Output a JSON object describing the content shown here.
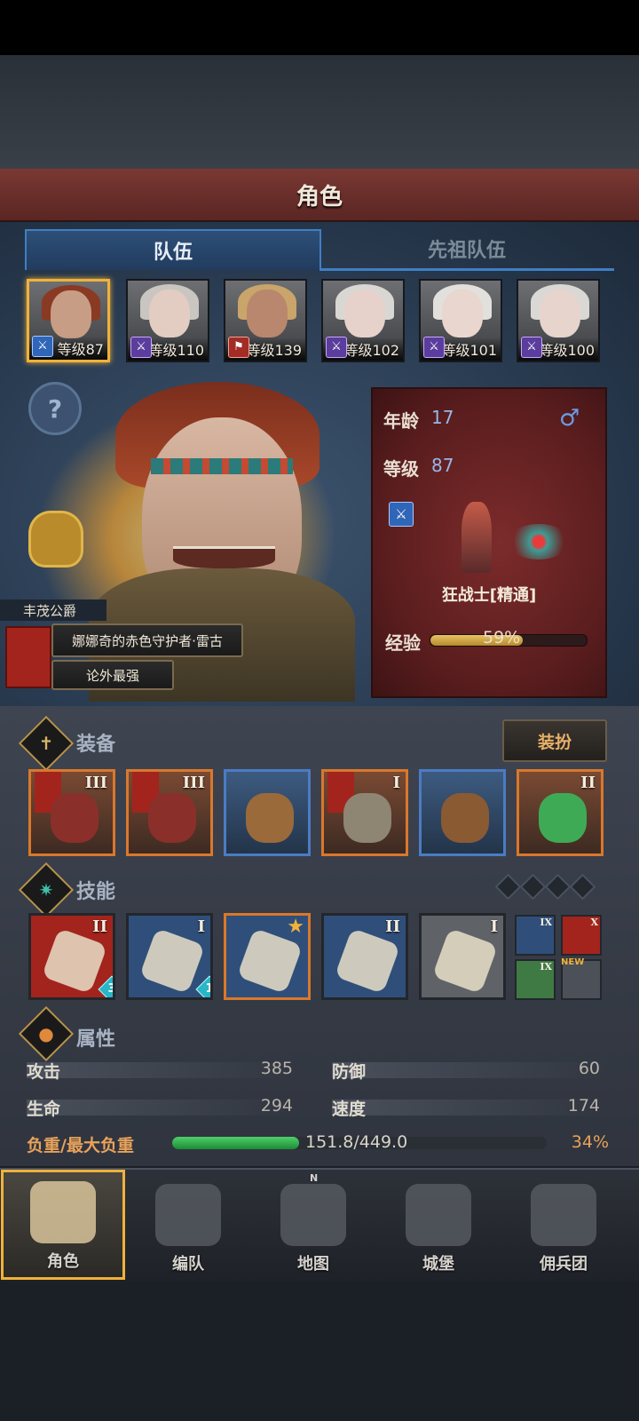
{
  "header": {
    "title": "角色"
  },
  "tabs": [
    {
      "label": "队伍",
      "active": true
    },
    {
      "label": "先祖队伍",
      "active": false
    }
  ],
  "team": [
    {
      "level_text": "等级87",
      "class": "blue",
      "selected": true,
      "hair": "#8a3a22",
      "skin": "#c79d86"
    },
    {
      "level_text": "等级110",
      "class": "purple",
      "selected": false,
      "hair": "#c9c6c2",
      "skin": "#e3ccc2"
    },
    {
      "level_text": "等级139",
      "class": "red",
      "selected": false,
      "hair": "#c9a46b",
      "skin": "#b9876d"
    },
    {
      "level_text": "等级102",
      "class": "purple",
      "selected": false,
      "hair": "#d9d7d3",
      "skin": "#e6d2cb"
    },
    {
      "level_text": "等级101",
      "class": "purple",
      "selected": false,
      "hair": "#e2e0dc",
      "skin": "#e9d6cf"
    },
    {
      "level_text": "等级100",
      "class": "purple",
      "selected": false,
      "hair": "#dad8d4",
      "skin": "#e6d4cd"
    }
  ],
  "hero": {
    "title_tag": "丰茂公爵",
    "title_main": "娜娜奇的赤色守护者·雷古",
    "title_sub": "论外最强",
    "help_label": "?"
  },
  "info": {
    "age_label": "年龄",
    "age": "17",
    "gender_symbol": "♂",
    "level_label": "等级",
    "level": "87",
    "class_name": "狂战士[精通]",
    "exp_label": "经验",
    "exp_percent_text": "59%",
    "exp_fraction": 0.59
  },
  "equipment": {
    "title": "装备",
    "dress_button": "装扮",
    "slots": [
      {
        "tier": "III",
        "quality": "orange",
        "flag": true,
        "color": "#8b2f2a"
      },
      {
        "tier": "III",
        "quality": "orange",
        "flag": true,
        "color": "#8b2f2a"
      },
      {
        "tier": "",
        "quality": "blue",
        "flag": false,
        "color": "#9a6a3a"
      },
      {
        "tier": "I",
        "quality": "orange",
        "flag": true,
        "color": "#8e8573"
      },
      {
        "tier": "",
        "quality": "blue",
        "flag": false,
        "color": "#8a5a33"
      },
      {
        "tier": "II",
        "quality": "orange",
        "flag": false,
        "color": "#3faa55"
      }
    ]
  },
  "skills": {
    "title": "技能",
    "items": [
      {
        "tier": "II",
        "bg": "#a3241d",
        "badge": "3",
        "star": false
      },
      {
        "tier": "I",
        "bg": "#2f4f7a",
        "badge": "1",
        "star": false
      },
      {
        "tier": "",
        "bg": "#2f4f7a",
        "badge": "",
        "star": true
      },
      {
        "tier": "II",
        "bg": "#2f4f7a",
        "badge": "",
        "star": false
      },
      {
        "tier": "I",
        "bg": "#5f6368",
        "badge": "",
        "star": false
      }
    ],
    "minis": [
      {
        "tier": "IX",
        "bg": "#2f4f7a"
      },
      {
        "tier": "X",
        "bg": "#a3241d"
      },
      {
        "tier": "IX",
        "bg": "#3f7a45"
      },
      {
        "tier": "",
        "bg": "#4c5058"
      }
    ],
    "new_label": "NEW"
  },
  "attributes": {
    "title": "属性",
    "attack_label": "攻击",
    "attack": "385",
    "defense_label": "防御",
    "defense": "60",
    "hp_label": "生命",
    "hp": "294",
    "speed_label": "速度",
    "speed": "174",
    "load_label": "负重/最大负重",
    "load_text": "151.8/449.0",
    "load_percent_text": "34%",
    "load_fraction": 0.34
  },
  "nav": [
    {
      "label": "角色",
      "active": true
    },
    {
      "label": "编队",
      "active": false
    },
    {
      "label": "地图",
      "active": false
    },
    {
      "label": "城堡",
      "active": false
    },
    {
      "label": "佣兵团",
      "active": false
    }
  ],
  "compass_letter": "N"
}
